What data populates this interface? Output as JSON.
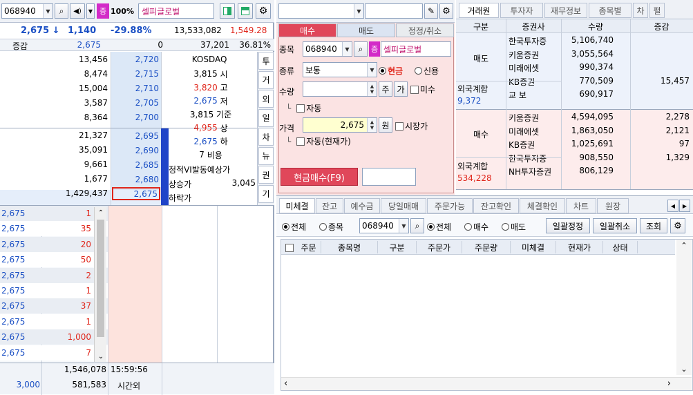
{
  "left_toolbar": {
    "code": "068940",
    "jeung": "증",
    "pct": "100%",
    "name": "셀피글로벌"
  },
  "summary": {
    "price": "2,675",
    "change": "1,140",
    "rate": "-29.88%",
    "volume": "13,533,082",
    "prev_mark": "1,549.28",
    "label_change": "증감",
    "change_price": "2,675",
    "change_zero": "0",
    "volume2": "37,201",
    "rate2": "36.81%"
  },
  "orderbook": {
    "sell": [
      {
        "qty": "13,456",
        "price": "2,720"
      },
      {
        "qty": "8,474",
        "price": "2,715"
      },
      {
        "qty": "15,004",
        "price": "2,710"
      },
      {
        "qty": "3,587",
        "price": "2,705"
      },
      {
        "qty": "8,364",
        "price": "2,700"
      }
    ],
    "buy": [
      {
        "qty": "21,327",
        "price": "2,695"
      },
      {
        "qty": "35,091",
        "price": "2,690"
      },
      {
        "qty": "9,661",
        "price": "2,685"
      },
      {
        "qty": "1,677",
        "price": "2,680"
      },
      {
        "qty": "1,429,437",
        "price": "2,675"
      }
    ],
    "info": [
      {
        "v": "KOSDAQ",
        "k": ""
      },
      {
        "v": "3,815",
        "k": "시"
      },
      {
        "v": "3,820",
        "k": "고"
      },
      {
        "v": "2,675",
        "k": "저"
      },
      {
        "v": "3,815",
        "k": "기준"
      },
      {
        "v": "4,955",
        "k": "상"
      },
      {
        "v": "2,675",
        "k": "하"
      },
      {
        "v": "7",
        "k": "비용"
      }
    ],
    "vi_label": "정적VI발동예상가",
    "up_label": "상승가",
    "up_value": "3,045",
    "down_label": "하락가",
    "side_tabs": [
      "투",
      "거",
      "외",
      "일",
      "차",
      "뉴",
      "권",
      "기"
    ]
  },
  "ticks": [
    {
      "price": "2,675",
      "qty": "1"
    },
    {
      "price": "2,675",
      "qty": "35"
    },
    {
      "price": "2,675",
      "qty": "20"
    },
    {
      "price": "2,675",
      "qty": "50"
    },
    {
      "price": "2,675",
      "qty": "2"
    },
    {
      "price": "2,675",
      "qty": "1"
    },
    {
      "price": "2,675",
      "qty": "37"
    },
    {
      "price": "2,675",
      "qty": "1"
    },
    {
      "price": "2,675",
      "qty": "1,000"
    },
    {
      "price": "2,675",
      "qty": "7"
    }
  ],
  "bottom_left": {
    "total": "1,546,078",
    "time": "15:59:56",
    "after": "3,000",
    "after_qty": "581,583",
    "after_label": "시간외"
  },
  "order": {
    "tabs": [
      "매수",
      "매도",
      "정정/취소"
    ],
    "label_code": "종목",
    "code": "068940",
    "jeung": "증",
    "name": "셀피글로벌",
    "label_type": "종류",
    "type": "보통",
    "cash": "현금",
    "credit": "신용",
    "label_qty": "수량",
    "btn_ju": "주",
    "btn_ga": "가",
    "misu": "미수",
    "auto": "자동",
    "label_price": "가격",
    "price": "2,675",
    "won": "원",
    "market": "시장가",
    "auto_current": "자동(현재가)",
    "submit": "현금매수(F9)"
  },
  "broker": {
    "tabs": [
      "거래원",
      "투자자",
      "재무정보",
      "종목별",
      "차",
      "펼"
    ],
    "headers": [
      "구분",
      "증권사",
      "수량",
      "증감"
    ],
    "sell_label": "매도",
    "sell_rows": [
      {
        "name": "한국투자증",
        "qty": "5,106,740",
        "diff": ""
      },
      {
        "name": "키움증권",
        "qty": "3,055,564",
        "diff": ""
      },
      {
        "name": "미래에셋",
        "qty": "990,374",
        "diff": ""
      },
      {
        "name": "KB증권",
        "qty": "770,509",
        "diff": "15,457"
      },
      {
        "name": "교 보",
        "qty": "690,917",
        "diff": ""
      }
    ],
    "foreign_label": "외국계합",
    "sell_foreign": "9,372",
    "buy_label": "매수",
    "buy_rows": [
      {
        "name": "키움증권",
        "qty": "4,594,095",
        "diff": "2,278"
      },
      {
        "name": "미래에셋",
        "qty": "1,863,050",
        "diff": "2,121"
      },
      {
        "name": "KB증권",
        "qty": "1,025,691",
        "diff": "97"
      },
      {
        "name": "한국투자증",
        "qty": "908,550",
        "diff": "1,329"
      },
      {
        "name": "NH투자증권",
        "qty": "806,129",
        "diff": ""
      }
    ],
    "buy_foreign": "534,228"
  },
  "bottom_tabs": [
    "미체결",
    "잔고",
    "예수금",
    "당일매매",
    "주문가능",
    "잔고확인",
    "체결확인",
    "차트",
    "원장"
  ],
  "filter": {
    "all": "전체",
    "stock": "종목",
    "code": "068940",
    "all2": "전체",
    "buy": "매수",
    "sell": "매도",
    "bulk_edit": "일괄정정",
    "bulk_cancel": "일괄취소",
    "query": "조회"
  },
  "order_headers": [
    "주문",
    "종목명",
    "구분",
    "주문가",
    "주문량",
    "미체결",
    "현재가",
    "상태"
  ]
}
